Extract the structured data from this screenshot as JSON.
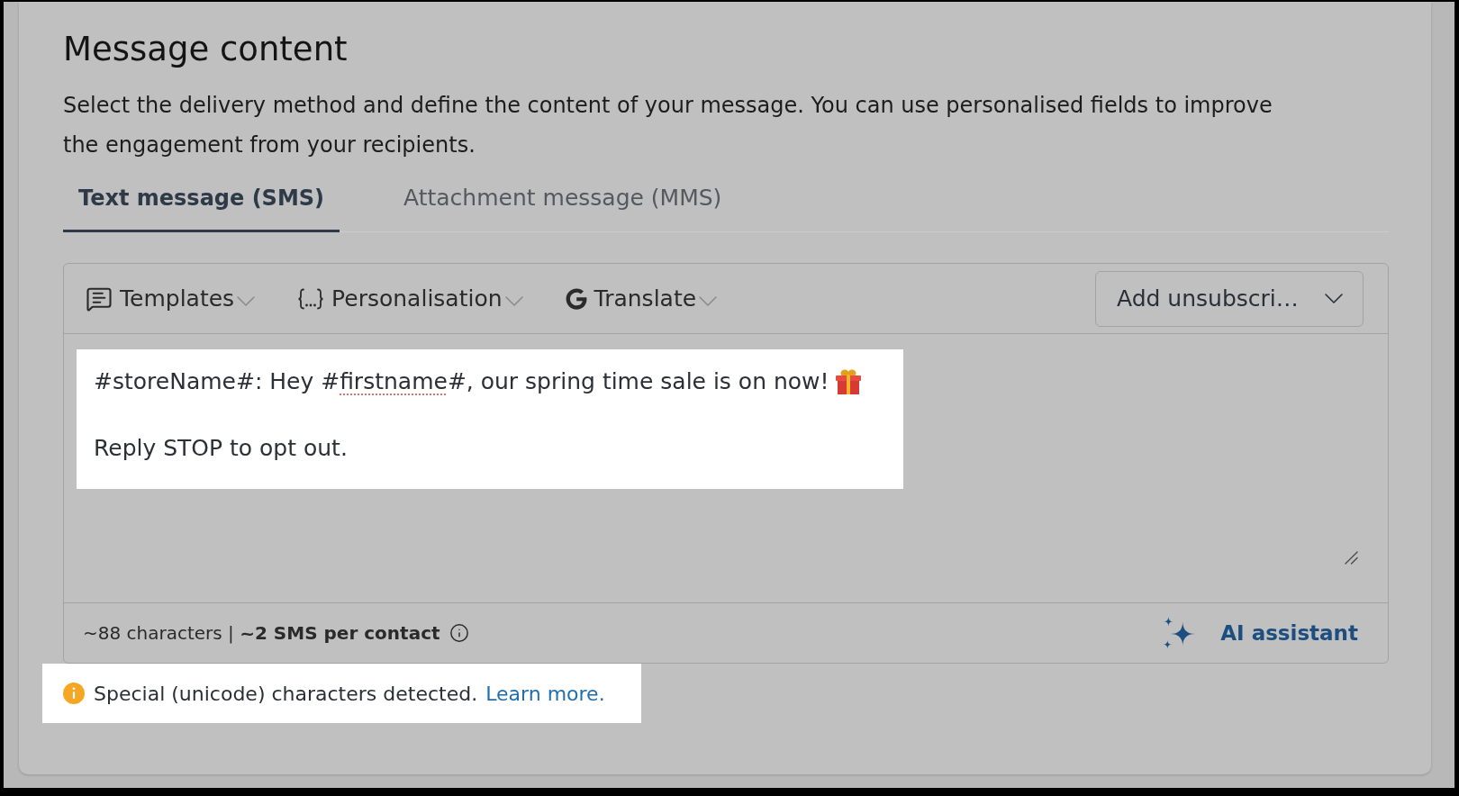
{
  "section": {
    "title": "Message content",
    "description": "Select the delivery method and define the content of your message. You can use personalised fields to improve the engagement from your recipients."
  },
  "tabs": [
    {
      "label": "Text message (SMS)",
      "selected": true
    },
    {
      "label": "Attachment message (MMS)",
      "selected": false
    }
  ],
  "editor": {
    "toolbar": [
      {
        "label": "Templates"
      },
      {
        "label": "Personalisation"
      },
      {
        "label": "Translate"
      }
    ],
    "unsubscribe_select": {
      "value": "Add unsubscri…"
    },
    "message": {
      "highlighted": true,
      "paragraphs": [
        {
          "segments": [
            {
              "text": "#storeName#: Hey #",
              "spellcheck_error": false
            },
            {
              "text": "firstname",
              "spellcheck_error": true
            },
            {
              "text": "#, our spring time sale is on now!",
              "spellcheck_error": false
            }
          ]
        },
        {
          "segments": [
            {
              "text": "Reply STOP to opt out.",
              "spellcheck_error": false
            }
          ]
        }
      ]
    },
    "counter": "~88 characters | **~2 SMS per contact**",
    "assistant_button": "AI assistant"
  },
  "notice": {
    "highlighted": true,
    "text": "Special (unicode) characters detected.",
    "link": "Learn more."
  }
}
